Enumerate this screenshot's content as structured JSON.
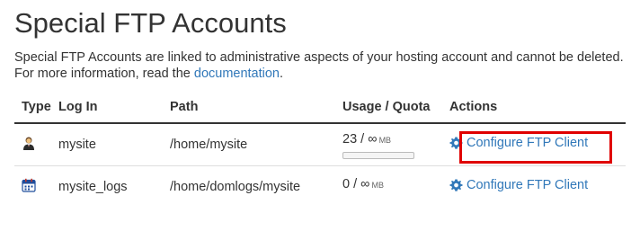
{
  "page": {
    "title": "Special FTP Accounts",
    "description_text": "Special FTP Accounts are linked to administrative aspects of your hosting account and cannot be deleted. For more information, read the",
    "documentation_link": "documentation",
    "description_end": "."
  },
  "table": {
    "headers": {
      "type": "Type",
      "login": "Log In",
      "path": "Path",
      "usage": "Usage / Quota",
      "actions": "Actions"
    },
    "rows": [
      {
        "type_icon": "user-icon",
        "login": "mysite",
        "path": "/home/mysite",
        "usage": "23 / ∞",
        "unit": "MB",
        "usage_fraction": 0,
        "action_label": "Configure FTP Client"
      },
      {
        "type_icon": "calendar-log-icon",
        "login": "mysite_logs",
        "path": "/home/domlogs/mysite",
        "usage": "0 / ∞",
        "unit": "MB",
        "action_label": "Configure FTP Client"
      }
    ]
  },
  "colors": {
    "link": "#3178b9",
    "highlight": "#e00000"
  }
}
